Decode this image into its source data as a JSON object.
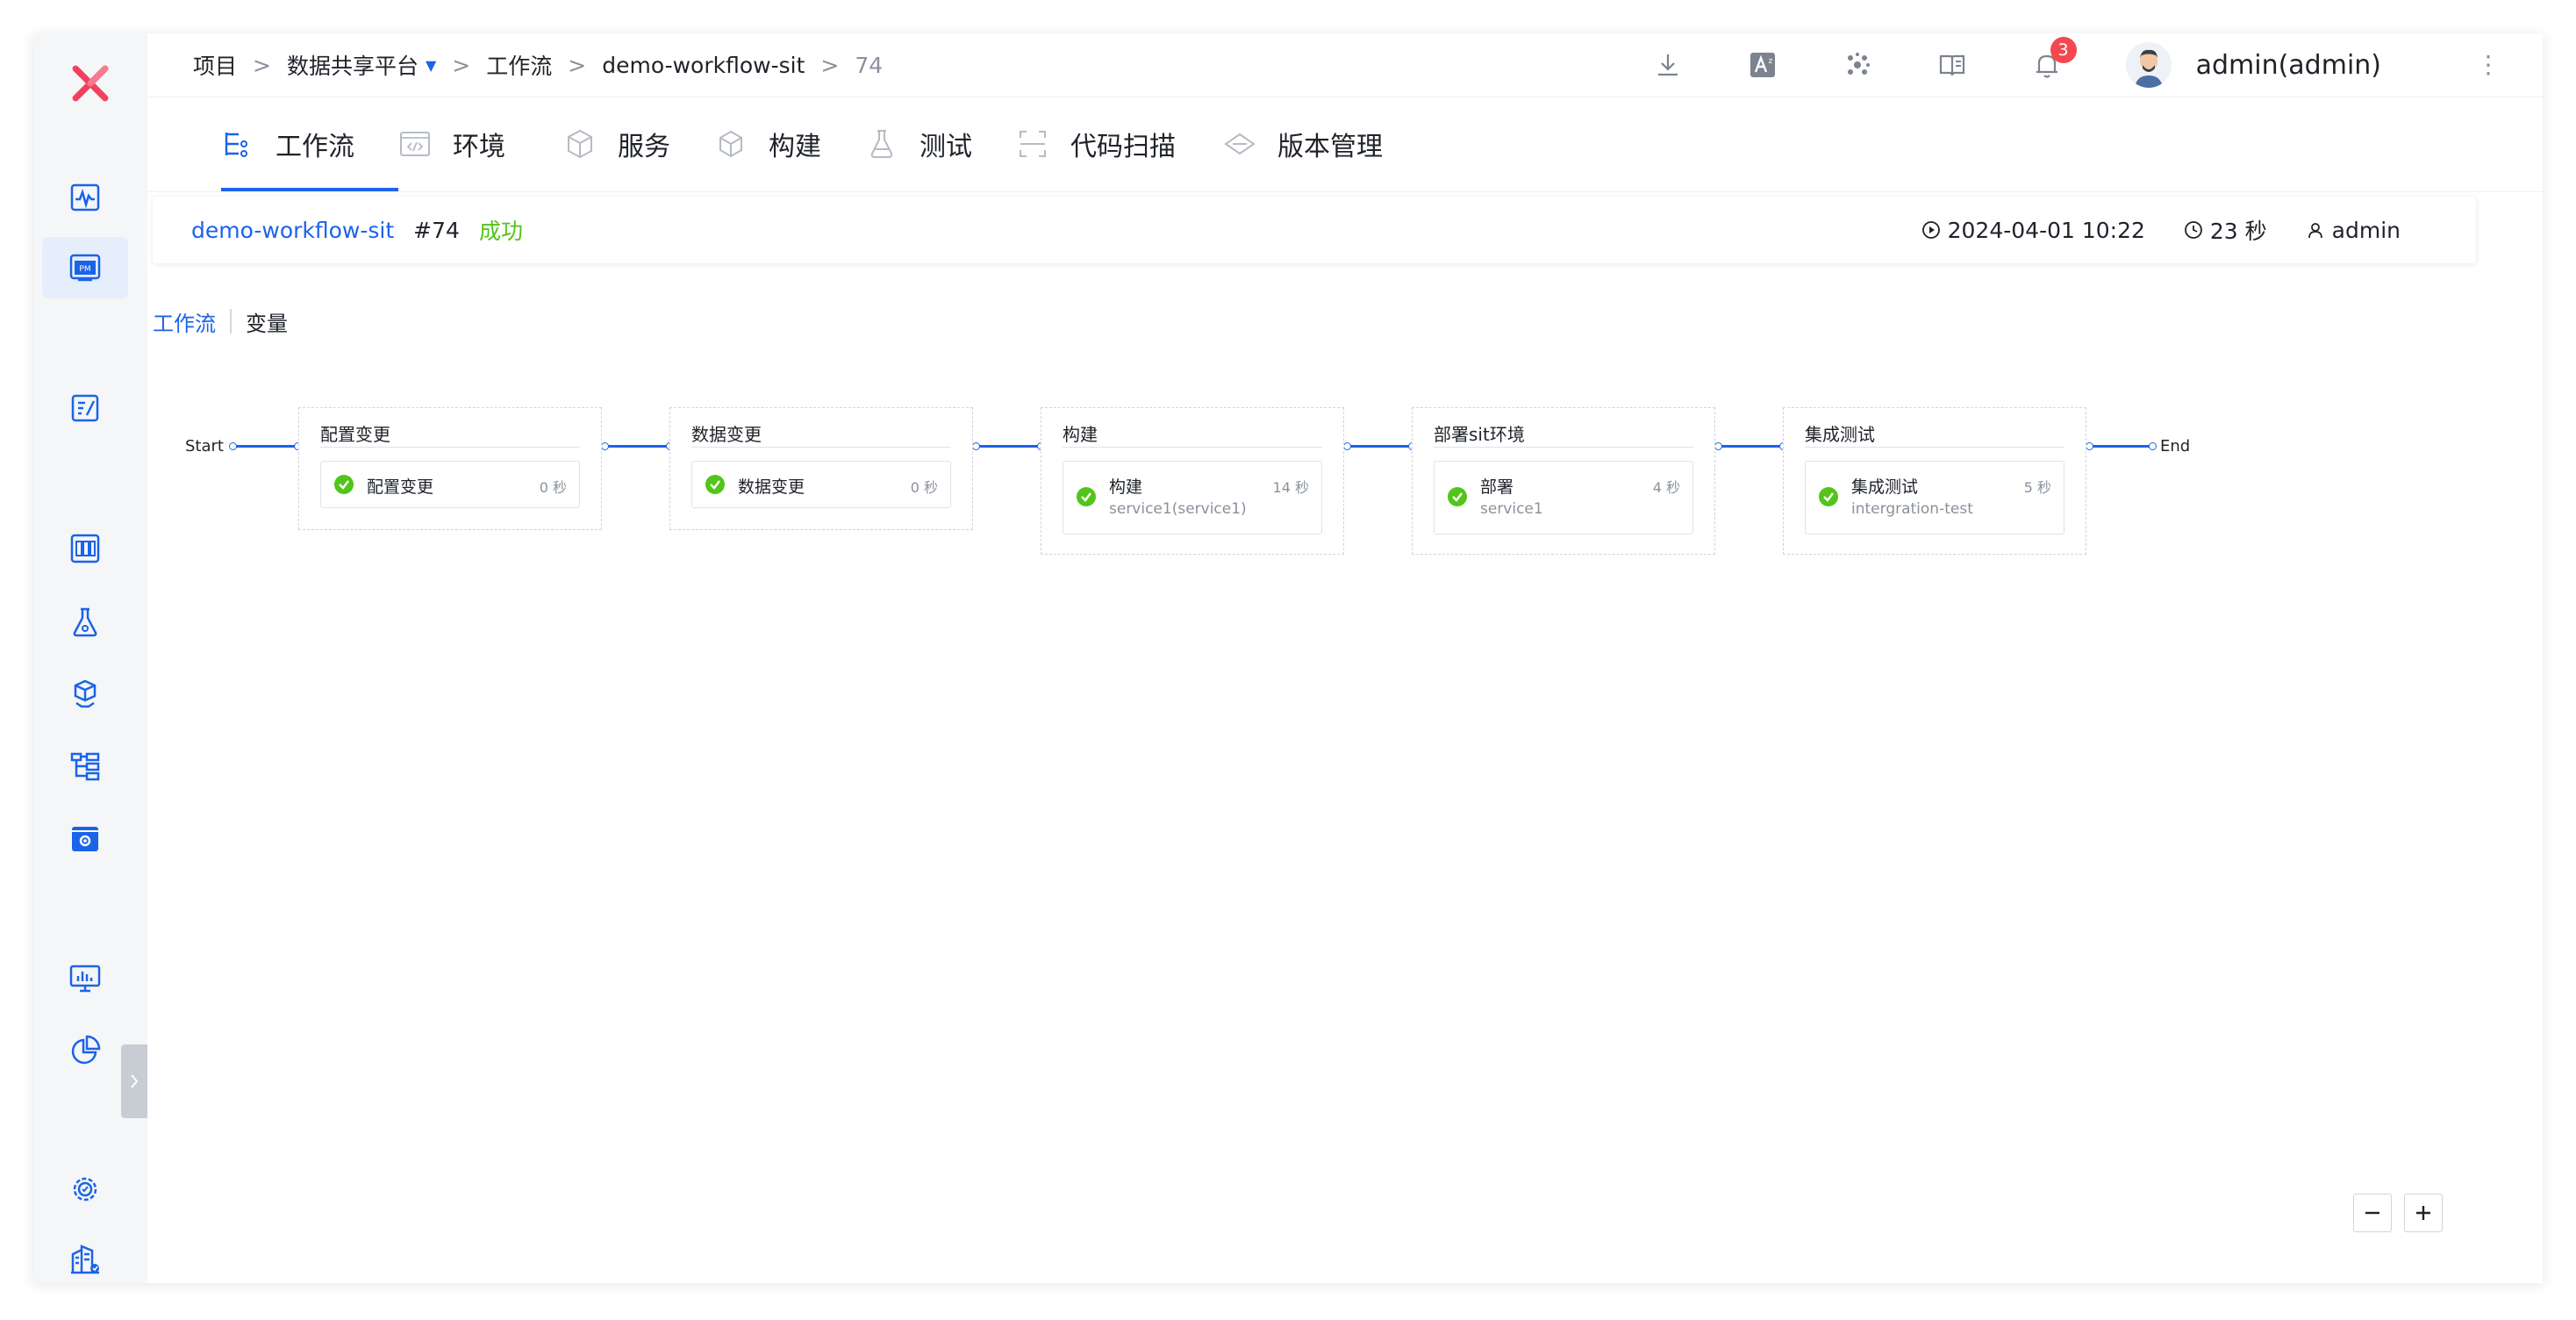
{
  "breadcrumb": {
    "project": "项目",
    "platform": "数据共享平台",
    "section": "工作流",
    "workflow": "demo-workflow-sit",
    "run": "74",
    "separator": ">"
  },
  "header": {
    "notification_count": "3",
    "user": "admin(admin)"
  },
  "tabs": [
    {
      "label": "工作流",
      "icon": "workflow-icon"
    },
    {
      "label": "环境",
      "icon": "environment-icon"
    },
    {
      "label": "服务",
      "icon": "service-icon"
    },
    {
      "label": "构建",
      "icon": "build-icon"
    },
    {
      "label": "测试",
      "icon": "test-icon"
    },
    {
      "label": "代码扫描",
      "icon": "code-scan-icon"
    },
    {
      "label": "版本管理",
      "icon": "version-icon"
    }
  ],
  "run": {
    "name": "demo-workflow-sit",
    "number": "#74",
    "status": "成功",
    "start_time": "2024-04-01 10:22",
    "duration": "23 秒",
    "user": "admin"
  },
  "subtabs": {
    "active": "工作流",
    "other": "变量"
  },
  "flow": {
    "start": "Start",
    "end": "End",
    "stages": [
      {
        "title": "配置变更",
        "jobs": [
          {
            "name": "配置变更",
            "sub": "",
            "time": "0 秒"
          }
        ]
      },
      {
        "title": "数据变更",
        "jobs": [
          {
            "name": "数据变更",
            "sub": "",
            "time": "0 秒"
          }
        ]
      },
      {
        "title": "构建",
        "jobs": [
          {
            "name": "构建",
            "sub": "service1(service1)",
            "time": "14 秒"
          }
        ]
      },
      {
        "title": "部署sit环境",
        "jobs": [
          {
            "name": "部署",
            "sub": "service1",
            "time": "4 秒"
          }
        ]
      },
      {
        "title": "集成测试",
        "jobs": [
          {
            "name": "集成测试",
            "sub": "intergration-test",
            "time": "5 秒"
          }
        ]
      }
    ]
  },
  "colors": {
    "accent": "#1b63e8",
    "success": "#52c41a",
    "logo": "#f0415f",
    "badge": "#f5474f"
  }
}
